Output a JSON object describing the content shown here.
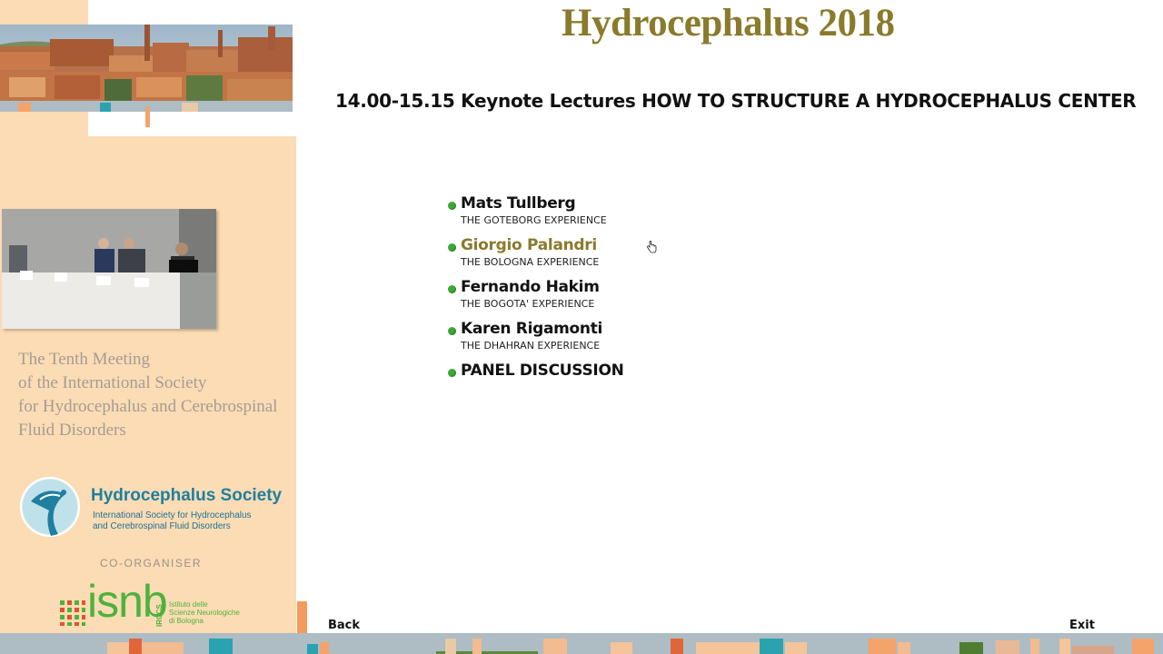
{
  "header": {
    "title": "Hydrocephalus 2018"
  },
  "session": {
    "heading": "14.00-15.15 Keynote Lectures HOW TO STRUCTURE A HYDROCEPHALUS CENTER"
  },
  "speakers": [
    {
      "name": "Mats Tullberg",
      "topic": "THE GOTEBORG EXPERIENCE",
      "active": false
    },
    {
      "name": "Giorgio Palandri",
      "topic": "THE BOLOGNA EXPERIENCE",
      "active": true
    },
    {
      "name": "Fernando Hakim",
      "topic": "THE BOGOTA' EXPERIENCE",
      "active": false
    },
    {
      "name": "Karen Rigamonti",
      "topic": "THE DHAHRAN EXPERIENCE",
      "active": false
    },
    {
      "name": "PANEL DISCUSSION",
      "topic": "",
      "active": false
    }
  ],
  "sidebar": {
    "meeting_lines": [
      "The Tenth Meeting",
      "of the International Society",
      "for Hydrocephalus and Cerebrospinal",
      "Fluid Disorders"
    ],
    "society": {
      "name": "Hydrocephalus Society",
      "sub_line1": "International Society for Hydrocephalus",
      "sub_line2": "and Cerebrospinal Fluid Disorders"
    },
    "co_organiser_label": "CO-ORGANISER",
    "isnb": {
      "word": "isnb",
      "irccs": "IRCCS",
      "desc_line1": "Istituto delle",
      "desc_line2": "Scienze Neurologiche",
      "desc_line3": "di Bologna"
    }
  },
  "nav": {
    "back_label": "Back",
    "exit_label": "Exit"
  },
  "colors": {
    "title_gold": "#8a7a2c",
    "panel_peach": "#fcdcb4",
    "bullet_green": "#3aa935",
    "society_blue": "#1f7fa0",
    "isnb_green": "#4db23e"
  }
}
